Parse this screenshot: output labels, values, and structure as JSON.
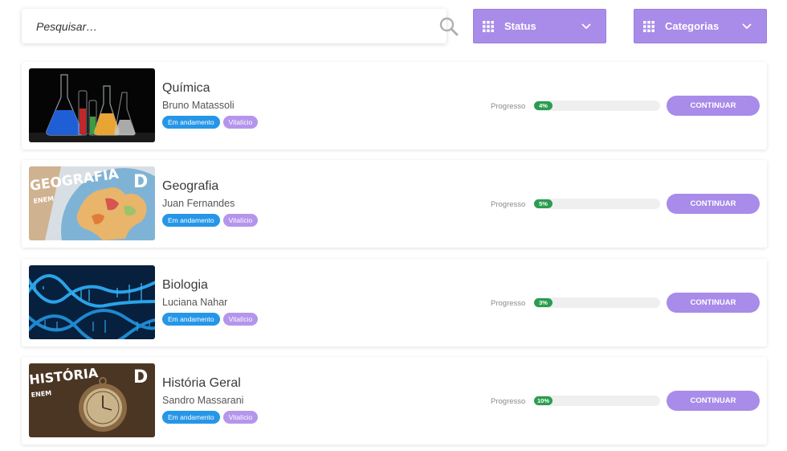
{
  "search": {
    "placeholder": "Pesquisar…"
  },
  "filters": {
    "status_label": "Status",
    "categories_label": "Categorias"
  },
  "colors": {
    "accent": "#a98be9",
    "badge_blue": "#2596e8",
    "badge_purple": "#b595ec",
    "progress_green": "#2a9d4e"
  },
  "courses": [
    {
      "title": "Química",
      "teacher": "Bruno Matassoli",
      "status_badge": "Em andamento",
      "access_badge": "Vitalício",
      "progress_label": "Progresso",
      "progress_text": "4%",
      "progress": 4,
      "button": "CONTINUAR"
    },
    {
      "title": "Geografia",
      "teacher": "Juan Fernandes",
      "status_badge": "Em andamento",
      "access_badge": "Vitalício",
      "progress_label": "Progresso",
      "progress_text": "5%",
      "progress": 5,
      "button": "CONTINUAR",
      "thumb_text": "GEOGRAFIA",
      "thumb_sub": "ENEM",
      "thumb_logo": "D"
    },
    {
      "title": "Biologia",
      "teacher": "Luciana Nahar",
      "status_badge": "Em andamento",
      "access_badge": "Vitalício",
      "progress_label": "Progresso",
      "progress_text": "3%",
      "progress": 3,
      "button": "CONTINUAR"
    },
    {
      "title": "História Geral",
      "teacher": "Sandro Massarani",
      "status_badge": "Em andamento",
      "access_badge": "Vitalício",
      "progress_label": "Progresso",
      "progress_text": "10%",
      "progress": 10,
      "button": "CONTINUAR",
      "thumb_text": "HISTÓRIA",
      "thumb_sub": "ENEM",
      "thumb_logo": "D"
    }
  ]
}
